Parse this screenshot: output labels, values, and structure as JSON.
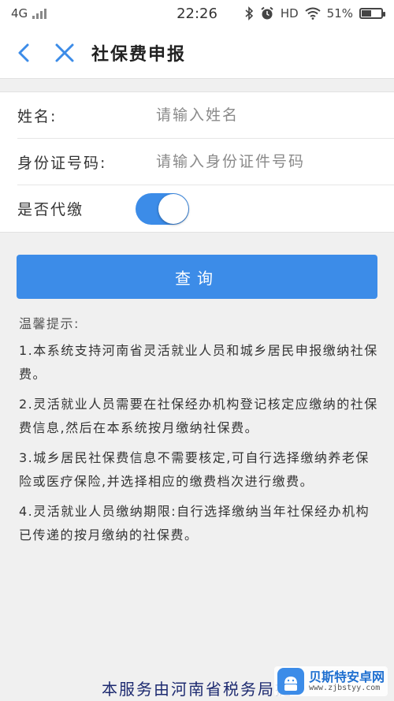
{
  "status_bar": {
    "network": "4G",
    "time": "22:26",
    "hd": "HD",
    "battery": "51%",
    "battery_level": 0.51
  },
  "header": {
    "title": "社保费申报",
    "back_icon": "chevron-left-icon",
    "close_icon": "close-icon",
    "accent": "#3c8ce8"
  },
  "form": {
    "name_label": "姓名:",
    "name_placeholder": "请输入姓名",
    "id_label": "身份证号码:",
    "id_placeholder": "请输入身份证件号码",
    "proxy_label": "是否代缴",
    "proxy_on": true
  },
  "query_button": "查询",
  "tips": {
    "title": "温馨提示:",
    "items": [
      "1.本系统支持河南省灵活就业人员和城乡居民申报缴纳社保费。",
      "2.灵活就业人员需要在社保经办机构登记核定应缴纳的社保费信息,然后在本系统按月缴纳社保费。",
      "3.城乡居民社保费信息不需要核定,可自行选择缴纳养老保险或医疗保险,并选择相应的缴费档次进行缴费。",
      "4.灵活就业人员缴纳期限:自行选择缴纳当年社保经办机构已传递的按月缴纳的社保费。"
    ]
  },
  "footer": "本服务由河南省税务局提",
  "watermark": {
    "name": "贝斯特安卓网",
    "url": "www.zjbstyy.com"
  }
}
